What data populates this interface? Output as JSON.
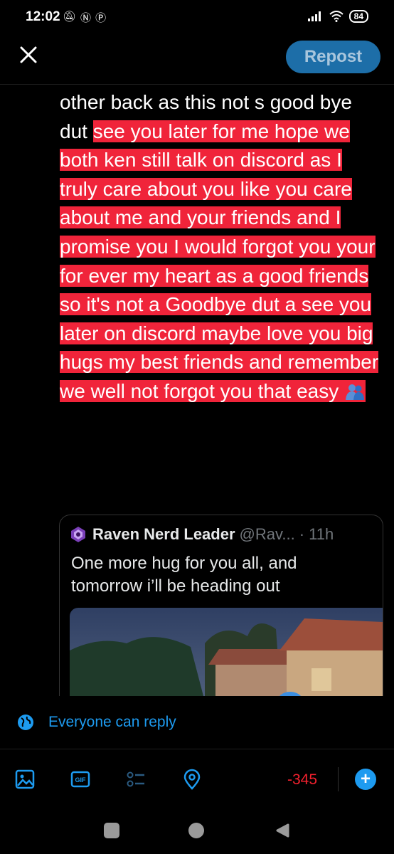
{
  "status_bar": {
    "time": "12:02",
    "battery": "84"
  },
  "header": {
    "repost_label": "Repost"
  },
  "post": {
    "plain_text": "other back as this not s good bye dut ",
    "highlighted_text": "see you later for me hope we both ken still talk on discord as I truly care about you like you care about me and your friends and I promise you I would forgot you your for ever my heart as a good friends so it's not a Goodbye dut a see you later on discord maybe love you big hugs my best friends and remember we well not forgot you that easy "
  },
  "quote": {
    "author": "Raven Nerd Leader",
    "handle": "@Rav...",
    "time": "· 11h",
    "text": "One more hug for you all, and tomorrow i’ll be heading out"
  },
  "reply_setting": {
    "label": "Everyone can reply"
  },
  "toolbar": {
    "counter": "-345",
    "add_label": "+"
  },
  "colors": {
    "accent": "#1d9bf0",
    "highlight": "#f0243a",
    "counter": "#f4212e"
  }
}
